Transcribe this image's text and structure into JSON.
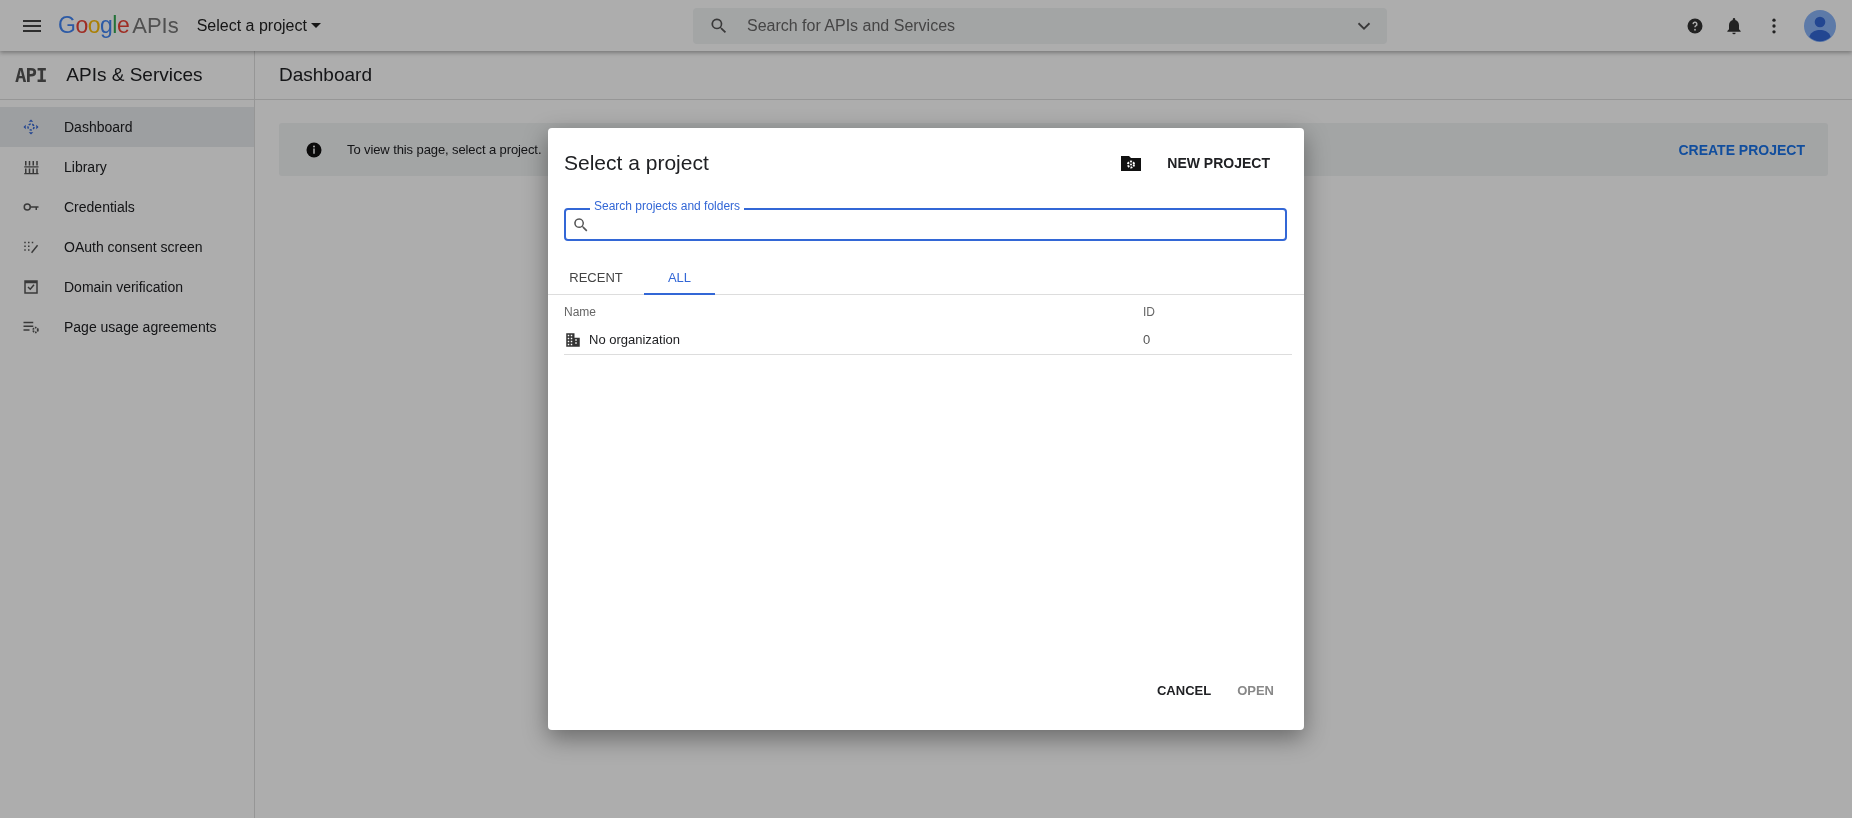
{
  "top_bar": {
    "logo": "Google",
    "product": "APIs",
    "project_picker": "Select a project",
    "search": {
      "placeholder": "Search for APIs and Services"
    }
  },
  "sidebar": {
    "badge": "API",
    "title": "APIs & Services",
    "items": [
      {
        "label": "Dashboard",
        "selected": true
      },
      {
        "label": "Library",
        "selected": false
      },
      {
        "label": "Credentials",
        "selected": false
      },
      {
        "label": "OAuth consent screen",
        "selected": false
      },
      {
        "label": "Domain verification",
        "selected": false
      },
      {
        "label": "Page usage agreements",
        "selected": false
      }
    ]
  },
  "page": {
    "title": "Dashboard",
    "banner": {
      "message": "To view this page, select a project.",
      "action": "CREATE PROJECT"
    }
  },
  "dialog": {
    "title": "Select a project",
    "new_project": "NEW PROJECT",
    "search": {
      "label": "Search projects and folders"
    },
    "tabs": [
      {
        "label": "RECENT",
        "selected": false
      },
      {
        "label": "ALL",
        "selected": true
      }
    ],
    "table": {
      "columns": [
        "Name",
        "ID"
      ],
      "rows": [
        {
          "name": "No organization",
          "id": "0"
        }
      ]
    },
    "buttons": [
      {
        "label": "CANCEL",
        "disabled": false
      },
      {
        "label": "OPEN",
        "disabled": true
      }
    ]
  }
}
